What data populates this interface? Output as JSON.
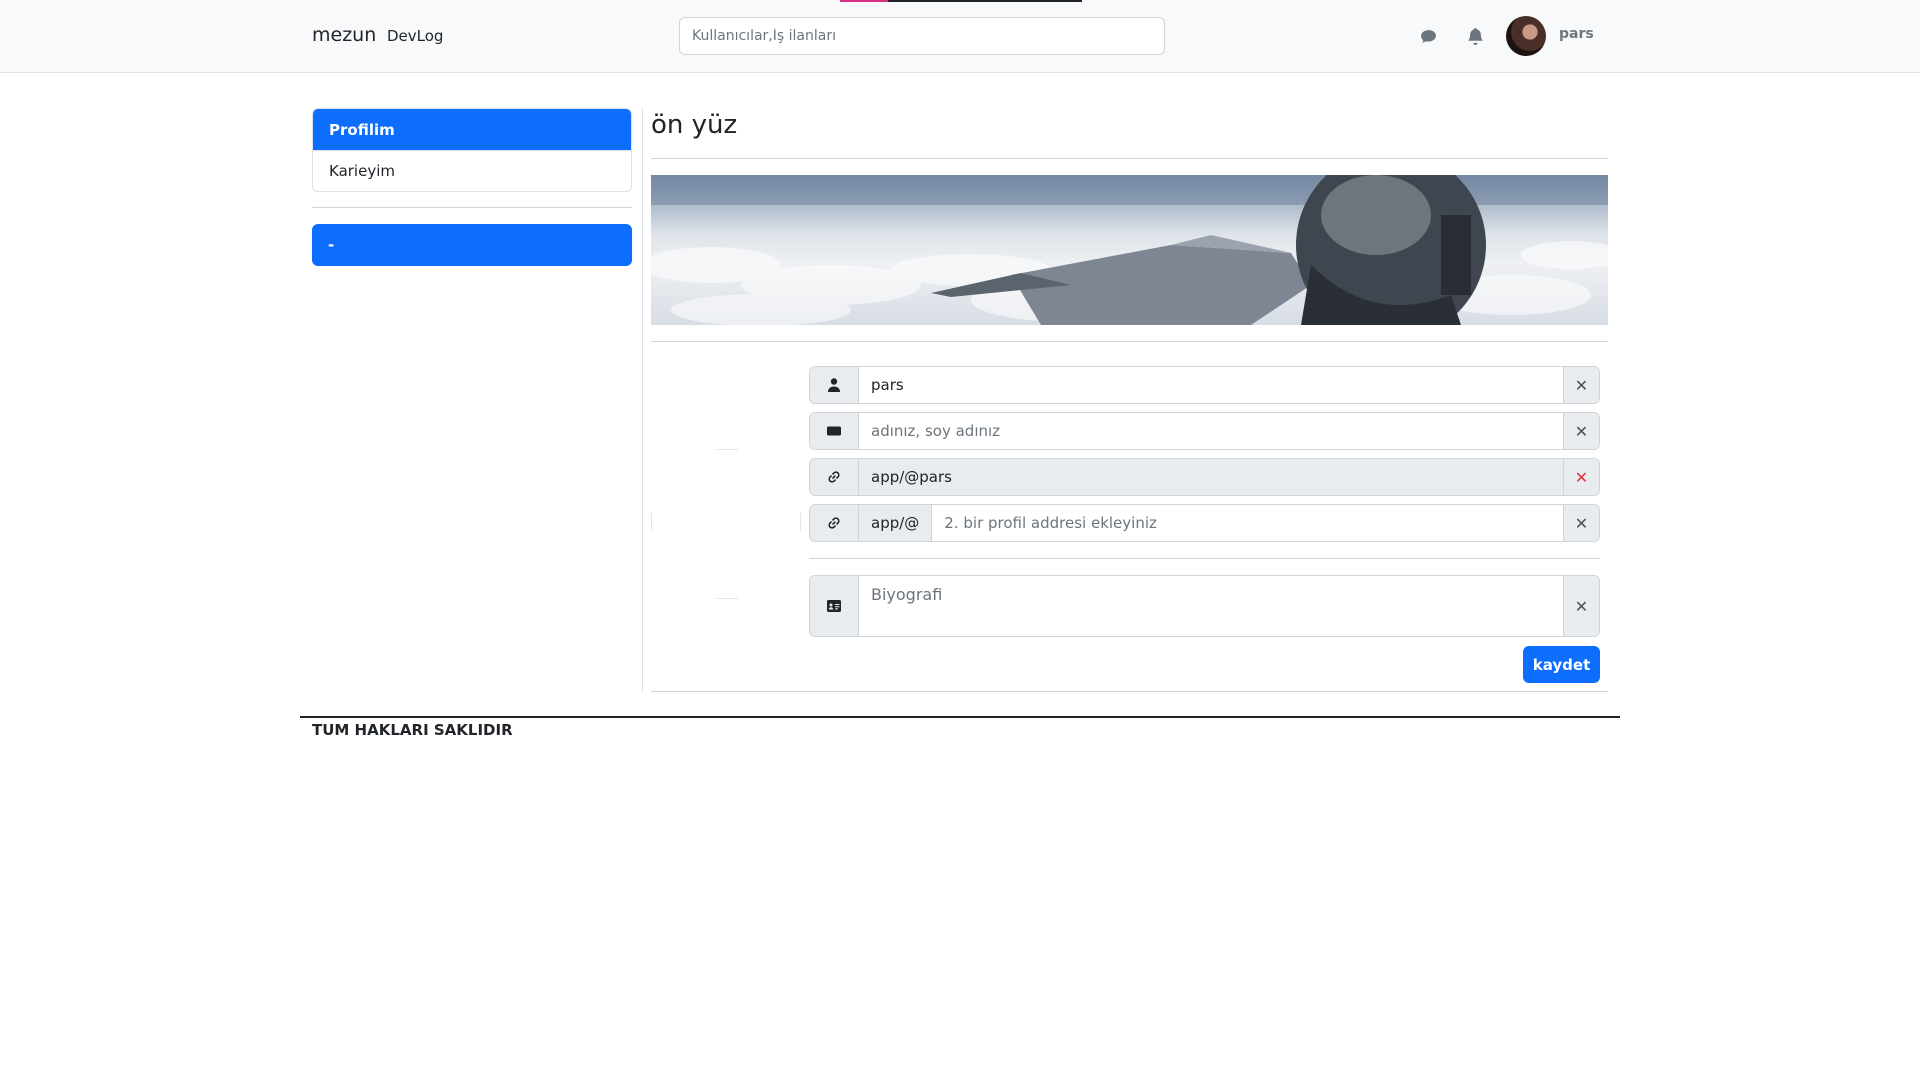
{
  "navbar": {
    "brand": "mezun",
    "nav_link": "DevLog",
    "search_placeholder": "Kullanıcılar,İş ilanları",
    "username": "pars",
    "icons": [
      "chat-icon",
      "bell-icon"
    ]
  },
  "sidebar": {
    "items": [
      {
        "label": "Profilim",
        "active": true
      },
      {
        "label": "Karieyim",
        "active": false
      }
    ],
    "button_label": "-"
  },
  "main": {
    "title": "ön yüz",
    "banner": "jet-pilot-above-clouds",
    "fields": {
      "username_value": "pars",
      "fullname_placeholder": "adınız, soy adınız",
      "profile_url_value": "app/@pars",
      "second_url_prefix": "app/@",
      "second_url_placeholder": "2. bir profil addresi ekleyiniz",
      "bio_placeholder": "Biyografi"
    },
    "clear_glyph": "✕",
    "save_label": "kaydet"
  },
  "colors": {
    "primary": "#0d6efd",
    "danger": "#dc3545",
    "addon_bg": "#e9ecef",
    "navbar_bg": "#f8f9fa"
  },
  "footer": {
    "text": "TUM HAKLARI SAKLIDIR"
  }
}
